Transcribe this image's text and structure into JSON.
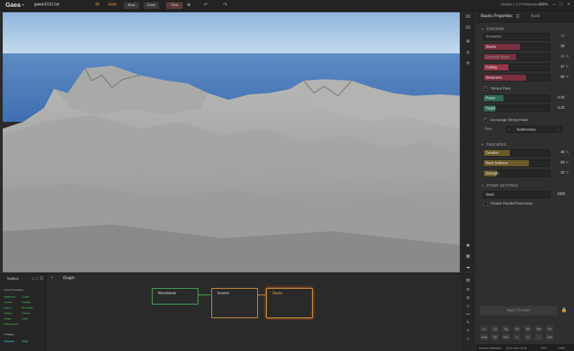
{
  "app": {
    "logo": "Gaea",
    "filename": "gaea/1012.tor",
    "resolution": "2k",
    "auto": "Auto",
    "btn_a": "Area",
    "btn_b": "Zoom",
    "btn_c": "Tone",
    "version": "Version 1.2.3 Professional",
    "zoom": "100%"
  },
  "panel": {
    "tab_properties": "Stacks Properties",
    "tab_build": "Build",
    "stacking_header": "STACKING",
    "props": [
      {
        "label": "Simulation",
        "value": "10",
        "unit": "",
        "pct": 0.0,
        "color": "#7a5a5a",
        "dim": true
      },
      {
        "label": "Stacks",
        "value": "28",
        "unit": "",
        "pct": 0.55,
        "color": "#7a3040",
        "dim": false
      },
      {
        "label": "Exposed Strata",
        "value": "49",
        "unit": "%",
        "pct": 0.49,
        "color": "#7a3040",
        "dim": true
      },
      {
        "label": "Folding",
        "value": "37",
        "unit": "%",
        "pct": 0.37,
        "color": "#9a3648",
        "dim": false
      },
      {
        "label": "Steepness",
        "value": "65",
        "unit": "%",
        "pct": 0.65,
        "color": "#7a3040",
        "dim": false
      }
    ],
    "terrace_pass": "Terrace Pass",
    "props2": [
      {
        "label": "Power",
        "value": "0.30",
        "unit": "",
        "pct": 0.3,
        "color": "#2f6b55"
      },
      {
        "label": "Height",
        "value": "0.33",
        "unit": "",
        "pct": 0.18,
        "color": "#2f6b55"
      }
    ],
    "encourage": "Encourage Strong Flows",
    "style_label": "Style",
    "style_value": "Sedimentary",
    "cascades_header": "CASCADES",
    "props3": [
      {
        "label": "Duration",
        "value": "40",
        "unit": "%",
        "pct": 0.4,
        "color": "#6b5a2a"
      },
      {
        "label": "Rock Softness",
        "value": "69",
        "unit": "%",
        "pct": 0.69,
        "color": "#6b5a2a"
      },
      {
        "label": "Strength",
        "value": "20",
        "unit": "%",
        "pct": 0.2,
        "color": "#6b5a2a"
      }
    ],
    "other_header": "OTHER SETTINGS",
    "seed_label": "Seed",
    "seed_value": "2930",
    "disable_parallel": "Disable Parallel Processing",
    "apply": "Apply Changes",
    "keys_row1": [
      "Lo",
      "Lg",
      "Eg",
      "Dif",
      "Mn",
      "Mw",
      "Vw"
    ],
    "keys_row2": [
      "Clmp",
      "Clp",
      "Bsn",
      "A",
      "Q",
      "^",
      "Shd"
    ],
    "status_a": "Resolve Optimizer",
    "status_b": "Go to New 10.28",
    "status_c": "1024",
    "status_d": "1.0MB"
  },
  "bottom": {
    "toolbox": "Toolbox",
    "graph": "Graph",
    "cat1": "Get Primitives",
    "tools_col1": [
      "Badlands",
      "Dunes",
      "Island",
      "Flakes",
      "Ridge",
      "Rainforests"
    ],
    "tools_col2": [
      "Crater",
      "Stratify",
      "Mountain",
      "Flakes",
      "Sand",
      ""
    ],
    "cat2": "Warps",
    "warp1": "Displace",
    "warp2": "Warp",
    "nodes": [
      {
        "title": "Worselands"
      },
      {
        "title": "Erosion"
      },
      {
        "title": "Stacks"
      }
    ]
  }
}
